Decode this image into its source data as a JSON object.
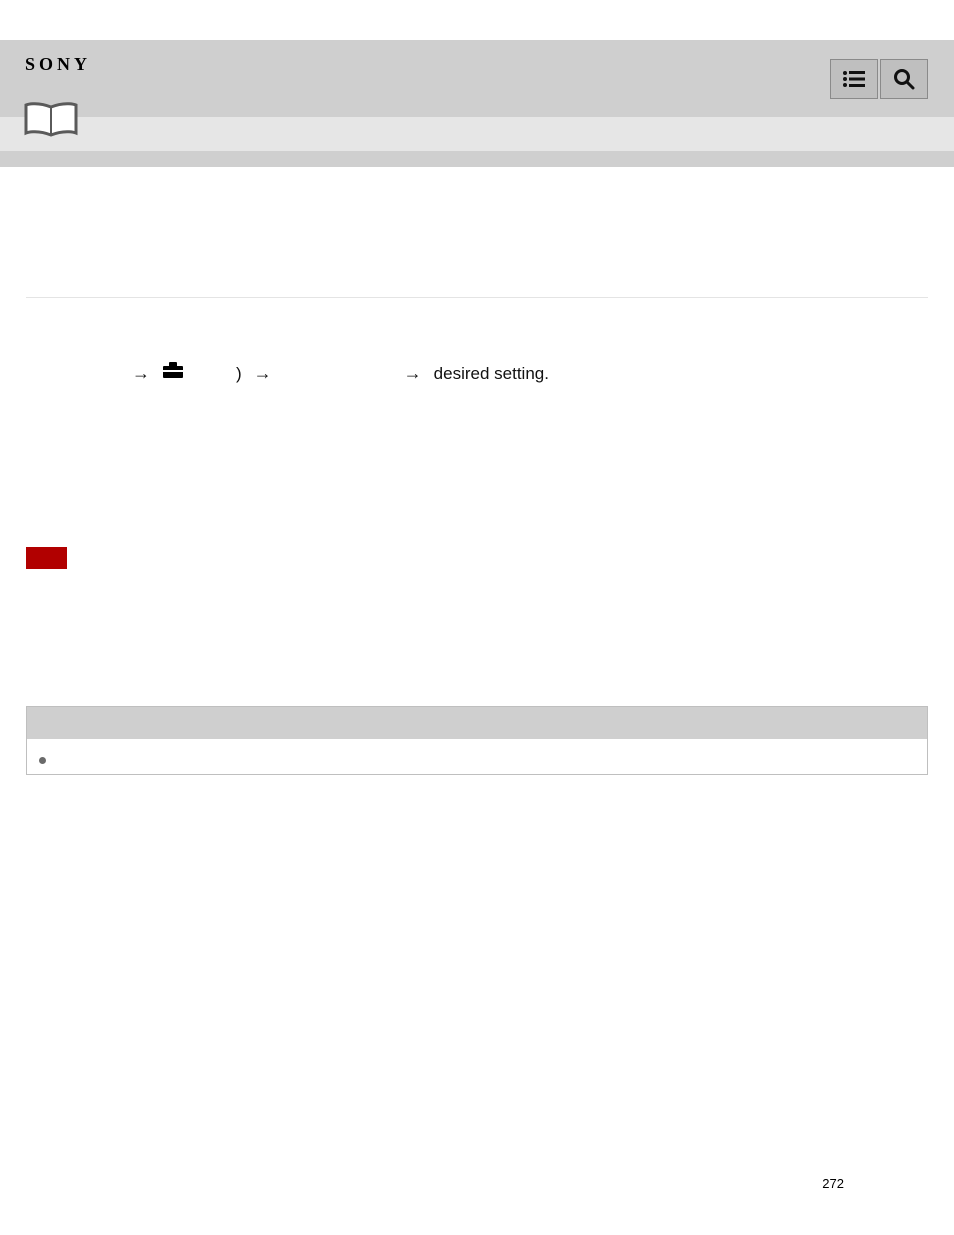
{
  "header": {
    "brand": "SONY"
  },
  "instruction": {
    "arrow": "→",
    "close_paren": ")",
    "tail": "desired setting."
  },
  "notes": {
    "items": [
      "",
      "",
      ""
    ],
    "boxed_item": ""
  },
  "page_number": "272"
}
